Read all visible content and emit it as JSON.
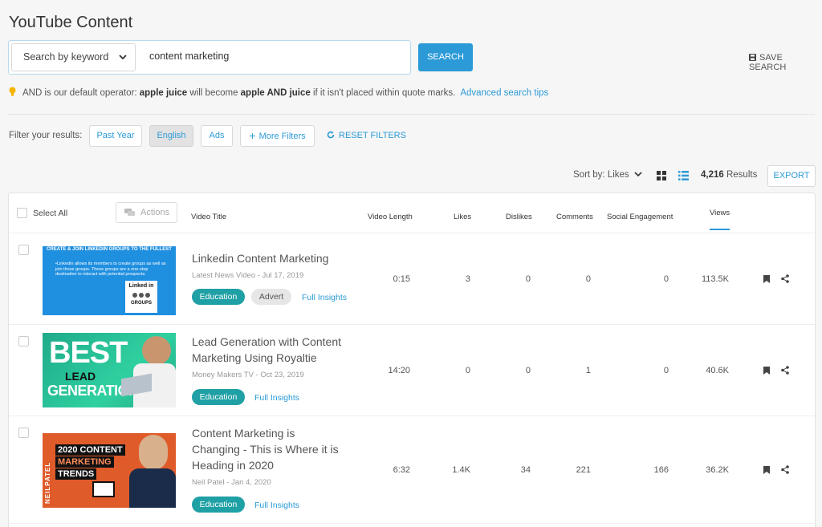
{
  "page": {
    "title": "YouTube Content"
  },
  "search": {
    "mode_label": "Search by keyword",
    "query": "content marketing",
    "button": "SEARCH",
    "save_label": "SAVE SEARCH"
  },
  "tip": {
    "prefix": "AND is our default operator: ",
    "ex1": "apple juice",
    "mid": " will become ",
    "ex2": "apple AND juice",
    "suffix": " if it isn't placed within quote marks.",
    "link": "Advanced search tips"
  },
  "filters": {
    "label": "Filter your results:",
    "past_year": "Past Year",
    "english": "English",
    "ads": "Ads",
    "more": "More Filters",
    "reset": "RESET FILTERS"
  },
  "toolbar": {
    "sort": "Sort by: Likes",
    "results_count": "4,216",
    "results_label": "Results",
    "export": "EXPORT"
  },
  "table": {
    "select_all": "Select All",
    "actions": "Actions",
    "headers": {
      "title": "Video Title",
      "length": "Video Length",
      "likes": "Likes",
      "dislikes": "Dislikes",
      "comments": "Comments",
      "engagement": "Social Engagement",
      "views": "Views"
    },
    "rows": [
      {
        "title_lines": [
          "Linkedin Content Marketing"
        ],
        "meta": "Latest News Video - Jul 17, 2019",
        "chip": "Education",
        "chip2": "Advert",
        "insights": "Full Insights",
        "length": "0:15",
        "likes": "3",
        "dislikes": "0",
        "comments": "0",
        "engagement": "0",
        "views": "113.5K",
        "thumb": {
          "heading": "CREATE & JOIN LINKEDIN GROUPS TO THE FULLEST",
          "body": "•Linkedin allows its members to create groups as well as join those groups. These groups are a one-stop destination to interact with potential prospects.",
          "logo": "Linked in",
          "logo2": "GROUPS"
        }
      },
      {
        "title_lines": [
          "Lead Generation with Content",
          "Marketing Using Royaltie"
        ],
        "meta": "Money Makers TV - Oct 23, 2019",
        "chip": "Education",
        "insights": "Full Insights",
        "length": "14:20",
        "likes": "0",
        "dislikes": "0",
        "comments": "1",
        "engagement": "0",
        "views": "40.6K",
        "thumb": {
          "big": "BEST",
          "mid": "LEAD",
          "low": "GENERATION"
        }
      },
      {
        "title_lines": [
          "Content Marketing is",
          "Changing - This is Where it is",
          "Heading in 2020"
        ],
        "meta": "Neil Patel - Jan 4, 2020",
        "chip": "Education",
        "insights": "Full Insights",
        "length": "6:32",
        "likes": "1.4K",
        "dislikes": "34",
        "comments": "221",
        "engagement": "166",
        "views": "36.2K",
        "thumb": {
          "side": "NEILPATEL",
          "l1": "2020 CONTENT",
          "l2": "MARKETING",
          "l3": "TRENDS"
        }
      }
    ]
  },
  "colors": {
    "accent": "#2b9ad7",
    "chip": "#1fa0a5"
  },
  "icons": [
    "chevron-down-icon",
    "save-icon",
    "bulb-icon",
    "plus-icon",
    "refresh-icon",
    "grid-view-icon",
    "list-view-icon",
    "actions-icon",
    "bookmark-icon",
    "share-icon"
  ]
}
